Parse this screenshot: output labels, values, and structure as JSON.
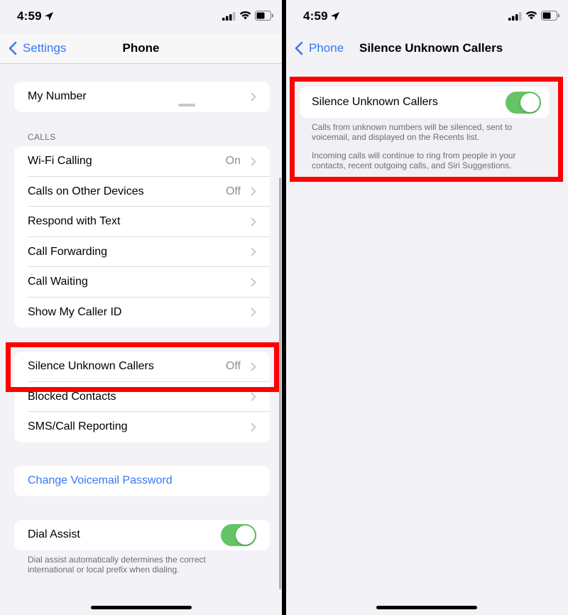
{
  "left": {
    "status": {
      "time": "4:59"
    },
    "nav": {
      "back_label": "Settings",
      "title": "Phone"
    },
    "my_number": {
      "label": "My Number"
    },
    "calls_section": {
      "header": "CALLS",
      "rows": [
        {
          "label": "Wi-Fi Calling",
          "value": "On"
        },
        {
          "label": "Calls on Other Devices",
          "value": "Off"
        },
        {
          "label": "Respond with Text",
          "value": ""
        },
        {
          "label": "Call Forwarding",
          "value": ""
        },
        {
          "label": "Call Waiting",
          "value": ""
        },
        {
          "label": "Show My Caller ID",
          "value": ""
        }
      ]
    },
    "blocking_section": {
      "rows": [
        {
          "label": "Silence Unknown Callers",
          "value": "Off"
        },
        {
          "label": "Blocked Contacts",
          "value": ""
        },
        {
          "label": "SMS/Call Reporting",
          "value": ""
        }
      ]
    },
    "voicemail": {
      "label": "Change Voicemail Password"
    },
    "dial_assist": {
      "label": "Dial Assist",
      "toggle_on": true,
      "footer": "Dial assist automatically determines the correct international or local prefix when dialing."
    }
  },
  "right": {
    "status": {
      "time": "4:59"
    },
    "nav": {
      "back_label": "Phone",
      "title": "Silence Unknown Callers"
    },
    "silence": {
      "label": "Silence Unknown Callers",
      "toggle_on": true,
      "footer_1": "Calls from unknown numbers will be silenced, sent to voicemail, and displayed on the Recents list.",
      "footer_2": "Incoming calls will continue to ring from people in your contacts, recent outgoing calls, and Siri Suggestions."
    }
  },
  "colors": {
    "accent": "#3478f6",
    "toggle_on": "#65c466",
    "highlight": "#ff0000",
    "background": "#f2f2f7"
  }
}
